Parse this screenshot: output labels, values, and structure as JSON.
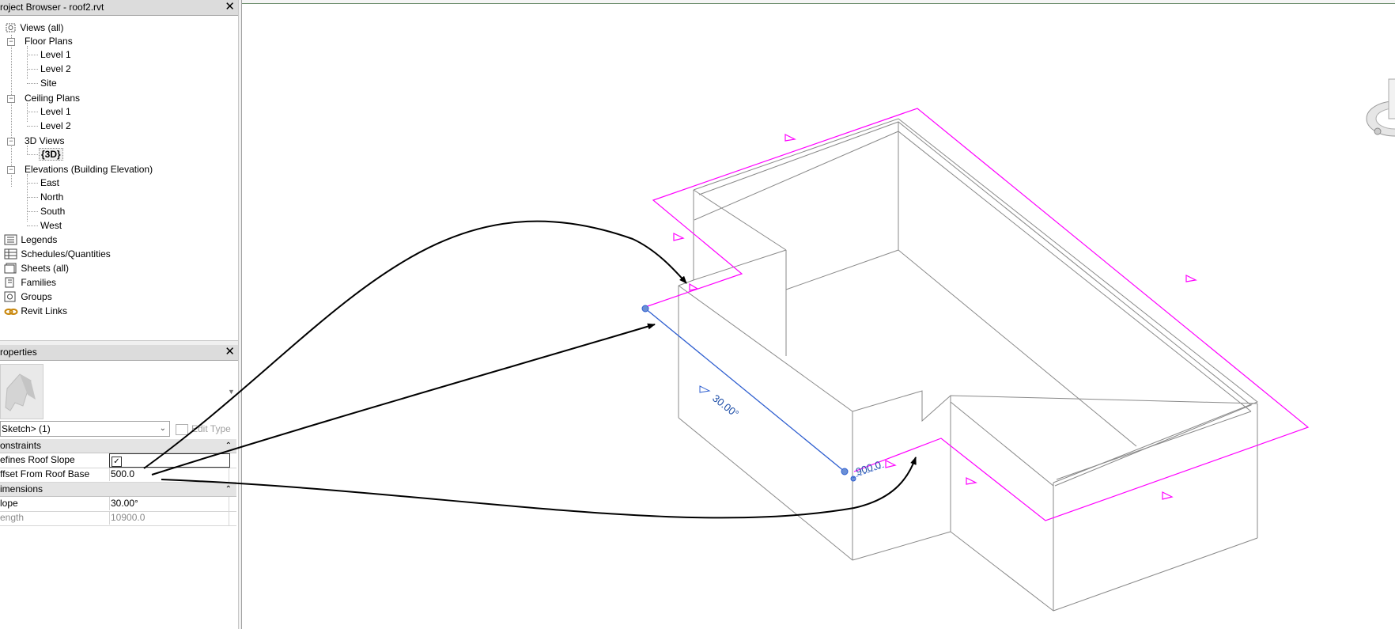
{
  "project_browser": {
    "title": "roject Browser - roof2.rvt",
    "tree": {
      "views_root": "Views (all)",
      "floor_plans": {
        "label": "Floor Plans",
        "items": [
          "Level 1",
          "Level 2",
          "Site"
        ]
      },
      "ceiling_plans": {
        "label": "Ceiling Plans",
        "items": [
          "Level 1",
          "Level 2"
        ]
      },
      "views_3d": {
        "label": "3D Views",
        "items": [
          "{3D}"
        ]
      },
      "elevations": {
        "label": "Elevations (Building Elevation)",
        "items": [
          "East",
          "North",
          "South",
          "West"
        ]
      },
      "legends": "Legends",
      "schedules": "Schedules/Quantities",
      "sheets": "Sheets (all)",
      "families": "Families",
      "groups": "Groups",
      "revit_links": "Revit Links"
    }
  },
  "properties": {
    "title": "roperties",
    "selector": "Sketch> (1)",
    "edit_type": "Edit Type",
    "groups": {
      "constraints": {
        "label": "onstraints",
        "defines_roof_slope_label": "efines Roof Slope",
        "defines_roof_slope_checked": true,
        "offset_label": "ffset From Roof Base",
        "offset_value": "500.0"
      },
      "dimensions": {
        "label": "imensions",
        "slope_label": "lope",
        "slope_value": "30.00°",
        "length_label": "ength",
        "length_value": "10900.0"
      }
    }
  },
  "viewport": {
    "slope_annotation": "30.00°",
    "offset_dimension": "900.0",
    "colors": {
      "sketch_lines": "#ff00ff",
      "selected_line": "#2f5fd0",
      "model_lines": "#8a8a8a",
      "arrows": "#000000"
    }
  },
  "icons": {
    "close": "close-icon",
    "collapse": "collapse-up-icon",
    "dropdown": "chevron-down-icon"
  }
}
